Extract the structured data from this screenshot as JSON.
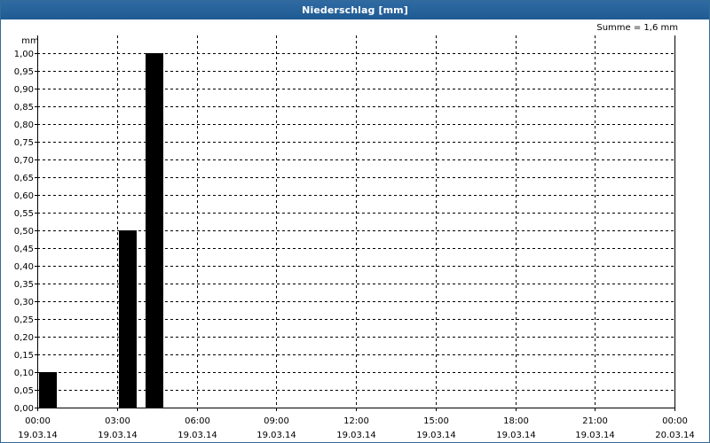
{
  "window": {
    "title": "Niederschlag [mm]"
  },
  "summary": {
    "text": "Summe = 1,6 mm"
  },
  "colors": {
    "title_bar": "#1f5b93",
    "bars": "#000000",
    "grid": "#000000"
  },
  "chart_data": {
    "type": "bar",
    "title": "Niederschlag [mm]",
    "ylabel": "mm",
    "xlabel": "",
    "ylim": [
      0,
      1
    ],
    "xlim": [
      "2014-03-19 00:00",
      "2014-03-20 00:00"
    ],
    "grid": true,
    "x_tick_labels": [
      [
        "00:00",
        "19.03.14"
      ],
      [
        "03:00",
        "19.03.14"
      ],
      [
        "06:00",
        "19.03.14"
      ],
      [
        "09:00",
        "19.03.14"
      ],
      [
        "12:00",
        "19.03.14"
      ],
      [
        "15:00",
        "19.03.14"
      ],
      [
        "18:00",
        "19.03.14"
      ],
      [
        "21:00",
        "19.03.14"
      ],
      [
        "00:00",
        "20.03.14"
      ]
    ],
    "y_tick_labels": [
      "0,00",
      "0,05",
      "0,10",
      "0,15",
      "0,20",
      "0,25",
      "0,30",
      "0,35",
      "0,40",
      "0,45",
      "0,50",
      "0,55",
      "0,60",
      "0,65",
      "0,70",
      "0,75",
      "0,80",
      "0,85",
      "0,90",
      "0,95",
      "1,00"
    ],
    "categories": [
      "2014-03-19 00:00",
      "2014-03-19 03:00",
      "2014-03-19 04:00"
    ],
    "values": [
      0.1,
      0.5,
      1.0
    ]
  }
}
